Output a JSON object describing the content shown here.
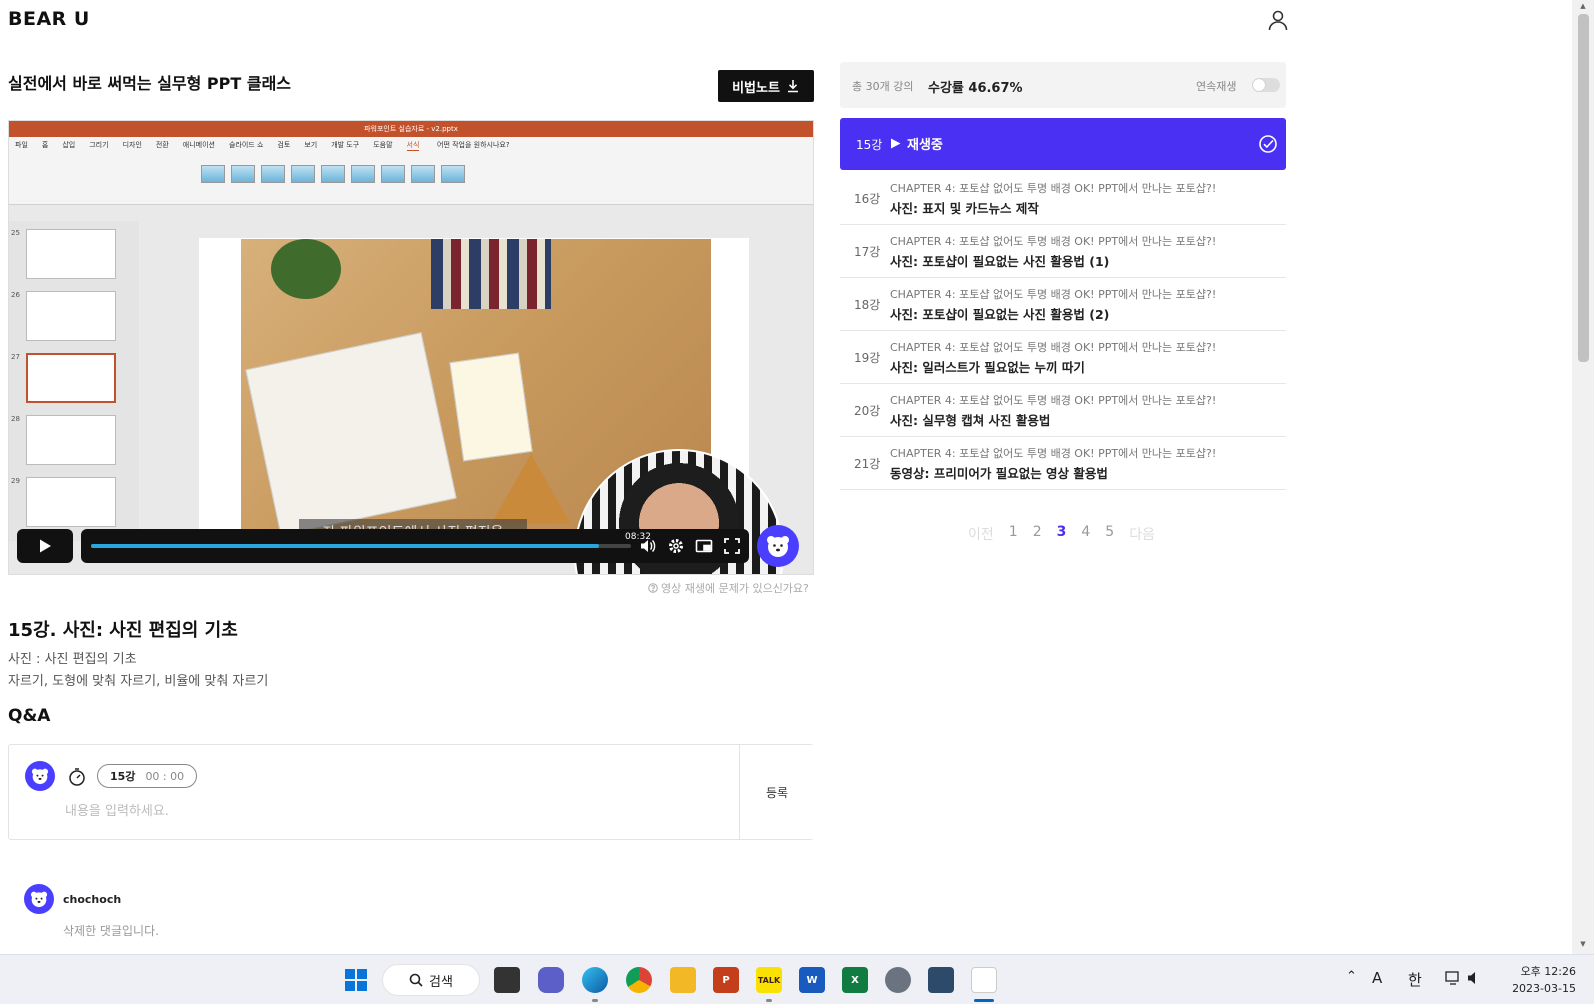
{
  "header": {
    "logo": "BEAR U",
    "user_icon": "user-icon"
  },
  "course": {
    "title": "실전에서 바로 써먹는 실무형 PPT 클래스",
    "note_button": "비법노트"
  },
  "video": {
    "ppt_window_title": "파워포인트 실습자료 - v2.pptx",
    "ppt_tabs": [
      "파일",
      "홈",
      "삽입",
      "그리기",
      "디자인",
      "전환",
      "애니메이션",
      "슬라이드 쇼",
      "검토",
      "보기",
      "개발 도구",
      "도움말",
      "서식"
    ],
    "ppt_search": "어떤 작업을 원하시나요?",
    "slide_numbers": [
      "25",
      "26",
      "27",
      "28",
      "29"
    ],
    "subtitle": "자 파워포인트에서 사진 편집을",
    "time_tooltip": "08:32",
    "progress": 0.94,
    "help_text": "영상 재생에 문제가 있으신가요?"
  },
  "lecture": {
    "title": "15강. 사진: 사진 편집의 기초",
    "desc1": "사진 : 사진 편집의 기초",
    "desc2": "자르기, 도형에 맞춰 자르기, 비율에 맞춰 자르기"
  },
  "qa": {
    "title": "Q&A",
    "lecture_tag": "15강",
    "timestamp": "00 : 00",
    "placeholder": "내용을 입력하세요.",
    "submit": "등록"
  },
  "comments": [
    {
      "user": "chochoch",
      "text": "삭제한 댓글입니다."
    }
  ],
  "progress_panel": {
    "total": "총 30개 강의",
    "rate": "수강률 46.67%",
    "autoplay_label": "연속재생",
    "autoplay_on": false
  },
  "now_playing": {
    "number": "15강",
    "label": "재생중"
  },
  "lectures": [
    {
      "number": "16강",
      "chapter": "CHAPTER 4: 포토샵 없어도 투명 배경 OK! PPT에서 만나는 포토샵?!",
      "title": "사진: 표지 및 카드뉴스 제작"
    },
    {
      "number": "17강",
      "chapter": "CHAPTER 4: 포토샵 없어도 투명 배경 OK! PPT에서 만나는 포토샵?!",
      "title": "사진: 포토샵이 필요없는 사진 활용법 (1)"
    },
    {
      "number": "18강",
      "chapter": "CHAPTER 4: 포토샵 없어도 투명 배경 OK! PPT에서 만나는 포토샵?!",
      "title": "사진: 포토샵이 필요없는 사진 활용법 (2)"
    },
    {
      "number": "19강",
      "chapter": "CHAPTER 4: 포토샵 없어도 투명 배경 OK! PPT에서 만나는 포토샵?!",
      "title": "사진: 일러스트가 필요없는 누끼 따기"
    },
    {
      "number": "20강",
      "chapter": "CHAPTER 4: 포토샵 없어도 투명 배경 OK! PPT에서 만나는 포토샵?!",
      "title": "사진: 실무형 캡쳐 사진 활용법"
    },
    {
      "number": "21강",
      "chapter": "CHAPTER 4: 포토샵 없어도 투명 배경 OK! PPT에서 만나는 포토샵?!",
      "title": "동영상: 프리미어가 필요없는 영상 활용법"
    }
  ],
  "pagination": {
    "prev": "이전",
    "pages": [
      "1",
      "2",
      "3",
      "4",
      "5"
    ],
    "current": "3",
    "next": "다음"
  },
  "taskbar": {
    "search_label": "검색",
    "tray_ime_a": "A",
    "tray_ime_han": "한",
    "clock_time": "오후 12:26",
    "clock_date": "2023-03-15"
  },
  "colors": {
    "brand": "#4a30f2",
    "ppt_orange": "#c2522b",
    "progress_blue": "#29a6de"
  }
}
